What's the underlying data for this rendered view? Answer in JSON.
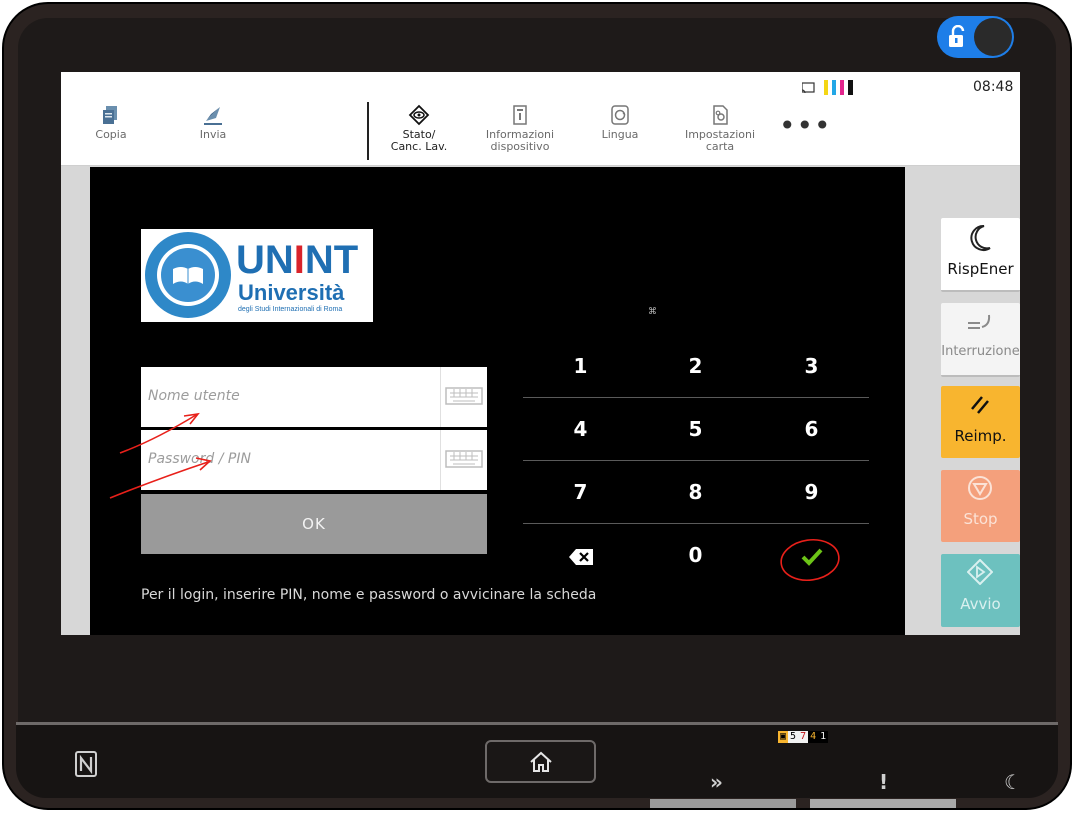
{
  "lock_toggle": {
    "icon": "unlock-icon",
    "state": "unlocked",
    "accent": "#1e7ee8"
  },
  "topbar": {
    "time": "08:48",
    "status_icons": [
      "cast-icon",
      "toner-yellow",
      "toner-cyan",
      "toner-magenta",
      "toner-black"
    ],
    "items": [
      {
        "label": "Copia",
        "icon": "copy-icon"
      },
      {
        "label": "Invia",
        "icon": "send-icon"
      },
      {
        "label": "Stato/\nCanc. Lav.",
        "icon": "status-icon"
      },
      {
        "label": "Informazioni\ndispositivo",
        "icon": "info-icon"
      },
      {
        "label": "Lingua",
        "icon": "language-icon"
      },
      {
        "label": "Impostazioni\ncarta",
        "icon": "paper-settings-icon"
      }
    ],
    "more": "•••"
  },
  "login": {
    "logo": {
      "line1": "UNINT",
      "line2": "Università",
      "line3": "degli Studi Internazionali di Roma",
      "seal_text": "Università degli Studi Internazionali · Roma"
    },
    "username_placeholder": "Nome utente",
    "password_placeholder": "Password / PIN",
    "ok_label": "OK",
    "hint": "Per il login, inserire PIN, nome e password o avvicinare la scheda",
    "tiny_mark": "⌘"
  },
  "keypad": {
    "keys": [
      "1",
      "2",
      "3",
      "4",
      "5",
      "6",
      "7",
      "8",
      "9"
    ],
    "zero": "0",
    "backspace_icon": "backspace-icon",
    "confirm_icon": "check-icon",
    "confirm_color": "#6cc417"
  },
  "side_buttons": {
    "energy": {
      "label": "RispEner",
      "icon": "moon-icon"
    },
    "interrupt": {
      "label": "Interruzione",
      "icon": "interrupt-icon"
    },
    "reset": {
      "label": "Reimp.",
      "icon": "reset-icon",
      "color": "#f8b52f"
    },
    "stop": {
      "label": "Stop",
      "icon": "stop-icon",
      "color": "#f4a07c"
    },
    "start": {
      "label": "Avvio",
      "icon": "start-icon",
      "color": "#6dc1bf"
    }
  },
  "bottom": {
    "nfc_icon": "nfc-icon",
    "home_icon": "home-icon",
    "counter": [
      "5",
      "7",
      "4",
      "1"
    ],
    "indicators": [
      "data-indicator-icon",
      "attention-icon",
      "sleep-icon"
    ],
    "indicator_glyphs": {
      "data": "»",
      "attention": "!",
      "sleep": "☾"
    }
  },
  "annotation_color": "#e8201a"
}
